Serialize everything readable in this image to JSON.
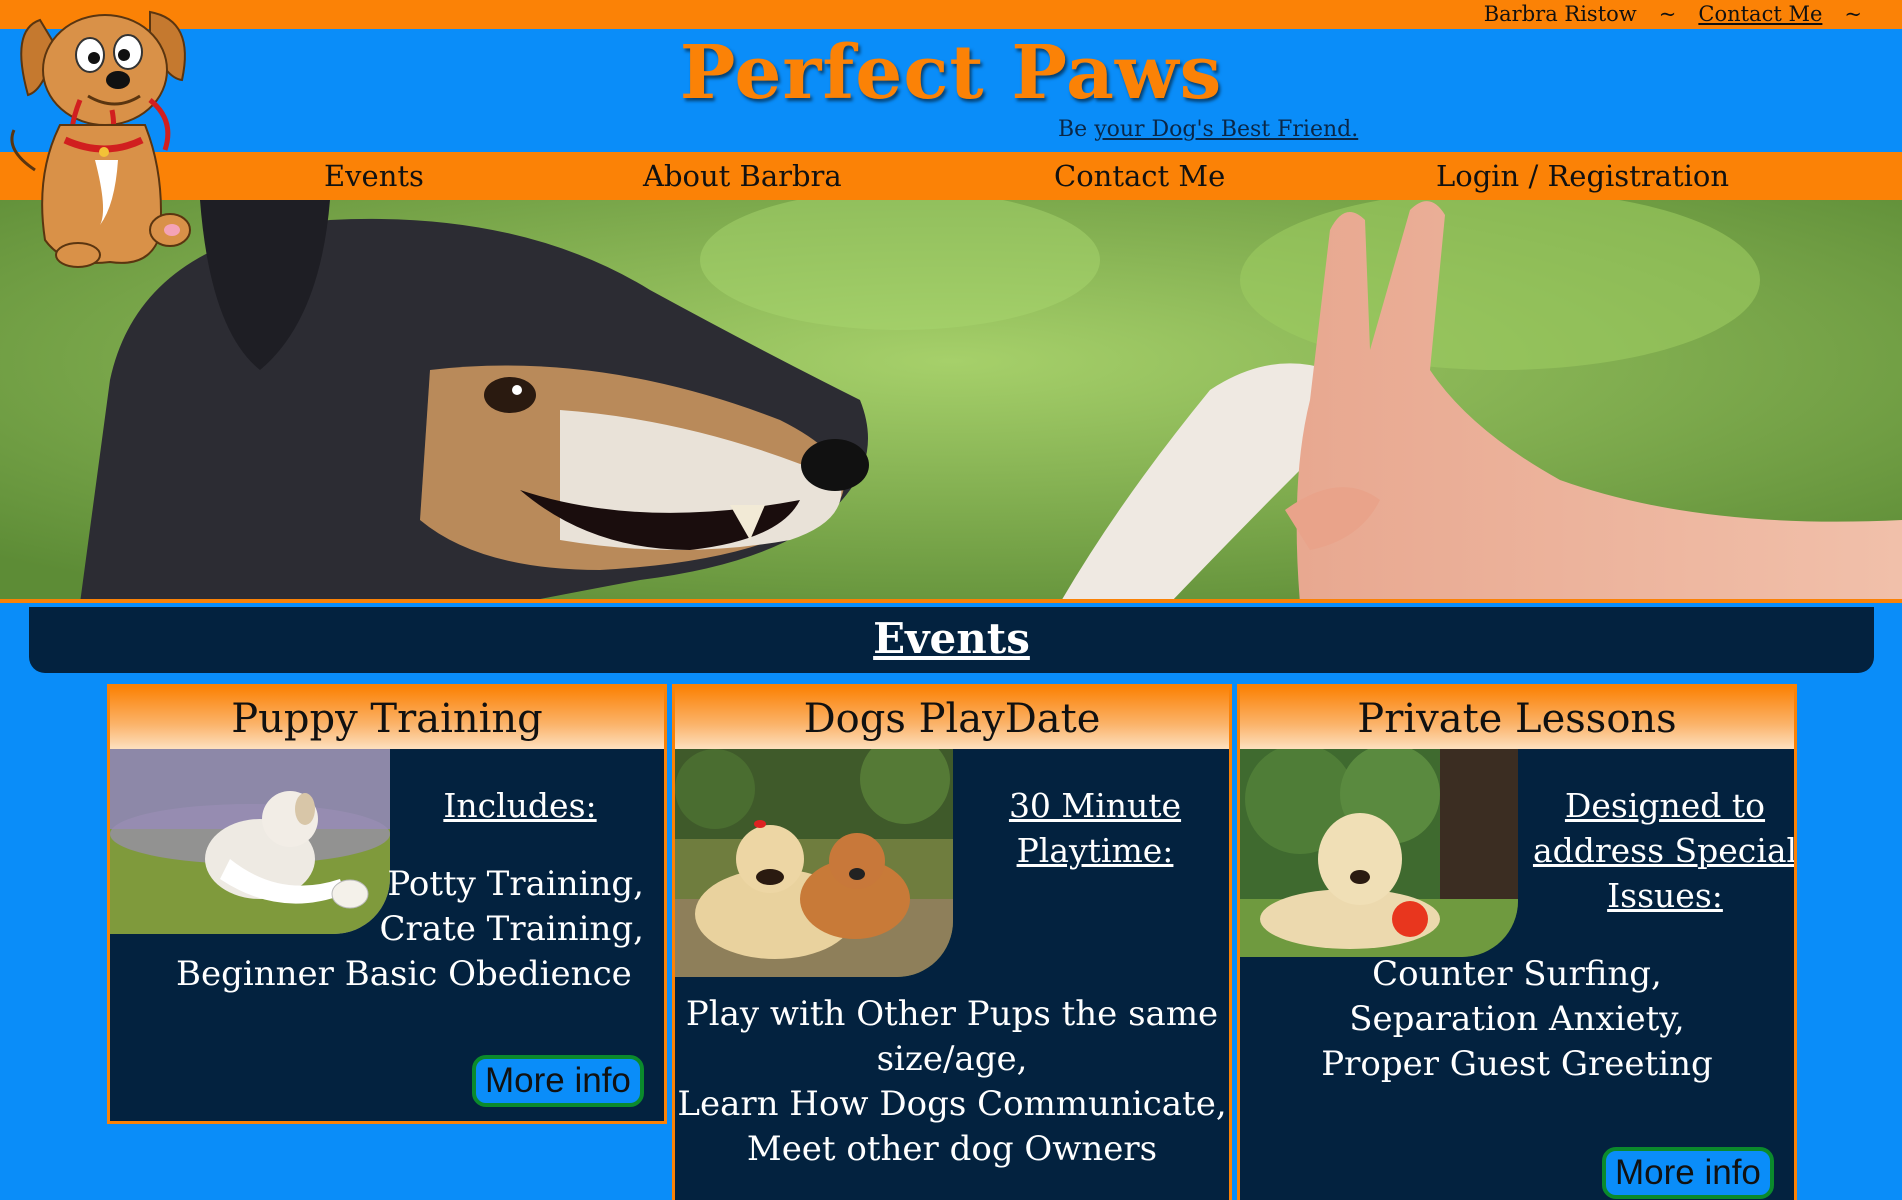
{
  "topbar": {
    "user": "Barbra Ristow",
    "sep1": "~",
    "contact": "Contact Me",
    "sep2": "~"
  },
  "header": {
    "title": "Perfect Paws",
    "tagline_prefix": "Be",
    "tagline_link": "your Dog's Best Friend."
  },
  "nav": {
    "events": "Events",
    "about": "About Barbra",
    "contact": "Contact Me",
    "login": "Login / Registration"
  },
  "section": {
    "title": "Events"
  },
  "cards": [
    {
      "title": "Puppy Training",
      "subtitle": "Includes:",
      "lines": [
        "Potty Training,",
        "Crate Training,",
        "Beginner Basic Obedience"
      ],
      "button": "More info"
    },
    {
      "title": "Dogs PlayDate",
      "subtitle_1": "30 Minute",
      "subtitle_2": "Playtime:",
      "lines": [
        "Play with Other Pups the same",
        "size/age,",
        "Learn How Dogs Communicate,",
        "Meet other dog Owners"
      ]
    },
    {
      "title": "Private Lessons",
      "subtitle_1": "Designed to",
      "subtitle_2": "address Special",
      "subtitle_3": "Issues:",
      "lines": [
        "Counter Surfing,",
        "Separation Anxiety,",
        "Proper Guest Greeting"
      ],
      "button": "More info"
    }
  ],
  "colors": {
    "orange": "#fb8206",
    "blue": "#0a8df9",
    "navy": "#03223f",
    "button_border": "#0b8a2c"
  }
}
